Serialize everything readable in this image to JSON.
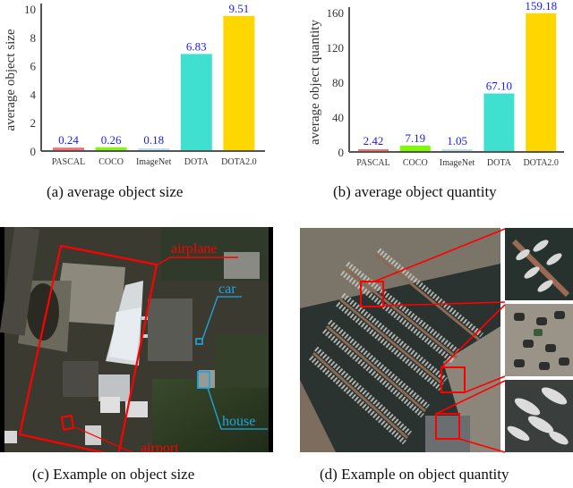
{
  "chart_data": [
    {
      "id": "a",
      "type": "bar",
      "title": "",
      "xlabel": "",
      "ylabel": "average object size",
      "categories": [
        "PASCAL",
        "COCO",
        "ImageNet",
        "DOTA",
        "DOTA2.0"
      ],
      "values": [
        0.24,
        0.26,
        0.18,
        6.83,
        9.51
      ],
      "value_labels": [
        "0.24",
        "0.26",
        "0.18",
        "6.83",
        "9.51"
      ],
      "colors": [
        "#ff6b6b",
        "#7cfc00",
        "#87ceeb",
        "#40e0d0",
        "#ffd700"
      ],
      "ylim": [
        0,
        10
      ],
      "yticks": [
        0,
        2,
        4,
        6,
        8,
        10
      ],
      "grid": false,
      "legend": "none",
      "value_label_color": "#1a1aff"
    },
    {
      "id": "b",
      "type": "bar",
      "title": "",
      "xlabel": "",
      "ylabel": "average object quantity",
      "categories": [
        "PASCAL",
        "COCO",
        "ImageNet",
        "DOTA",
        "DOTA2.0"
      ],
      "values": [
        2.42,
        7.19,
        1.05,
        67.1,
        159.18
      ],
      "value_labels": [
        "2.42",
        "7.19",
        "1.05",
        "67.10",
        "159.18"
      ],
      "colors": [
        "#ff6b6b",
        "#7cfc00",
        "#87ceeb",
        "#40e0d0",
        "#ffd700"
      ],
      "ylim": [
        0,
        160
      ],
      "yticks": [
        0,
        40,
        80,
        120,
        160
      ],
      "grid": false,
      "legend": "none",
      "value_label_color": "#1a1aff"
    }
  ],
  "captions": {
    "a": "(a)  average object size",
    "b": "(b)  average object quantity",
    "c": "(c)  Example on object size",
    "d": "(d)  Example on object quantity"
  },
  "example_size": {
    "annotations": [
      {
        "label": "airplane",
        "color": "#ff0000"
      },
      {
        "label": "car",
        "color": "#1fa7e0"
      },
      {
        "label": "house",
        "color": "#1fa7e0"
      },
      {
        "label": "airport",
        "color": "#ff0000"
      }
    ]
  },
  "example_quantity": {
    "box_color": "#ff0000",
    "insets": [
      "boats-at-dock",
      "parked-cars",
      "moored-yachts"
    ]
  }
}
